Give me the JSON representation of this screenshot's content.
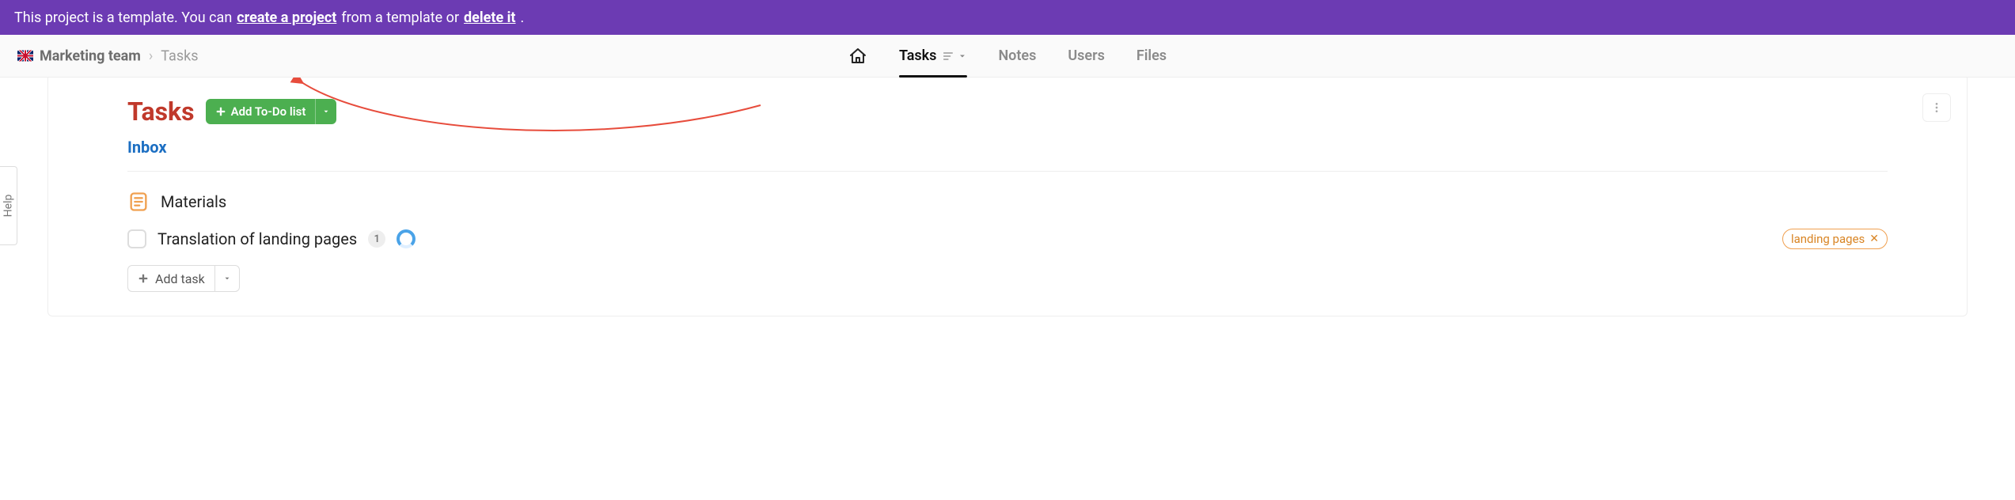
{
  "banner": {
    "prefix": "This project is a template. You can ",
    "create_link": "create a project",
    "middle": " from a template or ",
    "delete_link": "delete it",
    "suffix": "."
  },
  "breadcrumb": {
    "project": "Marketing team",
    "current": "Tasks"
  },
  "tabs": {
    "tasks": "Tasks",
    "notes": "Notes",
    "users": "Users",
    "files": "Files"
  },
  "help": {
    "label": "Help"
  },
  "page": {
    "title": "Tasks",
    "add_todo_label": "Add To-Do list",
    "inbox_label": "Inbox"
  },
  "list": {
    "materials": "Materials",
    "task1": "Translation of landing pages",
    "task1_count": "1",
    "tag1": "landing pages"
  },
  "actions": {
    "add_task": "Add task"
  }
}
